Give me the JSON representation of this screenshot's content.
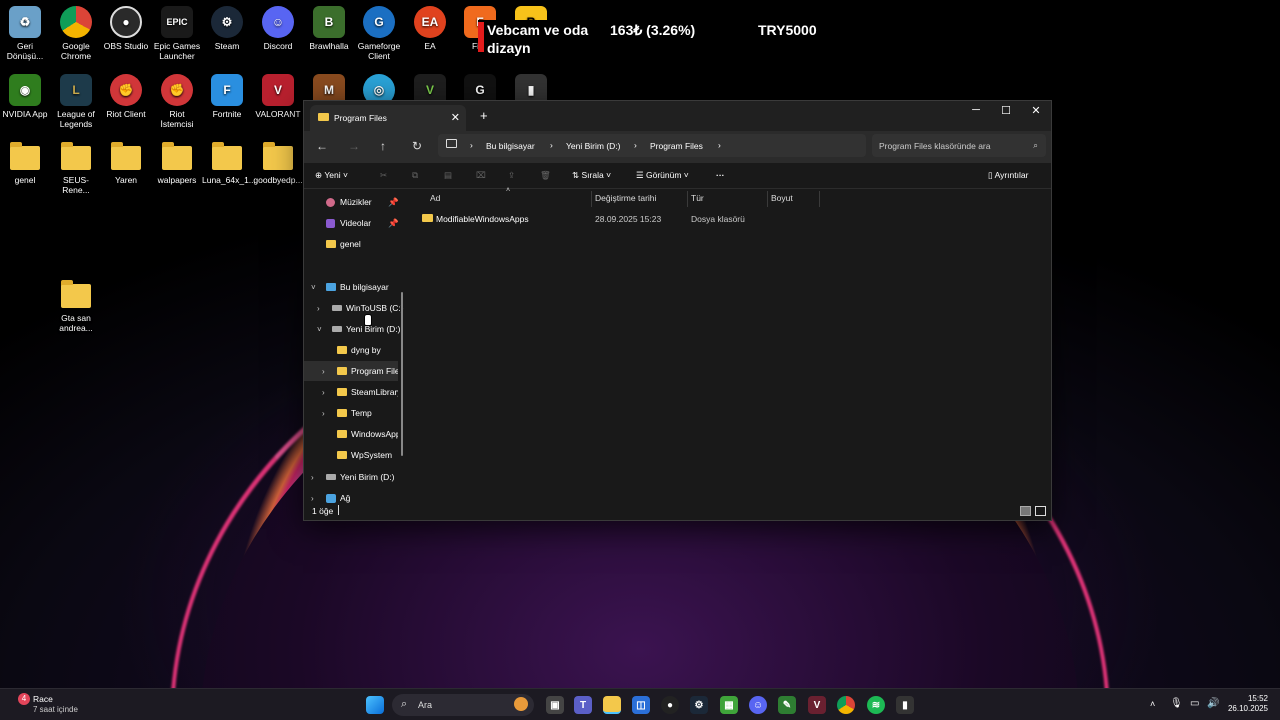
{
  "desktop": {
    "icons": [
      {
        "label": "Geri Dönüşü...",
        "icon": "recycle-bin-icon",
        "color": "#6aa0c8"
      },
      {
        "label": "Google Chrome",
        "icon": "chrome-icon",
        "color": "#2f8f46"
      },
      {
        "label": "OBS Studio",
        "icon": "obs-icon",
        "color": "#2a2a2a"
      },
      {
        "label": "Epic Games Launcher",
        "icon": "epic-games-icon",
        "color": "#1a1a1a"
      },
      {
        "label": "Steam",
        "icon": "steam-icon",
        "color": "#1b2838"
      },
      {
        "label": "Discord",
        "icon": "discord-icon",
        "color": "#5865f2"
      },
      {
        "label": "Brawlhalla",
        "icon": "brawlhalla-icon",
        "color": "#3b6e2c"
      },
      {
        "label": "Gameforge Client",
        "icon": "gameforge-icon",
        "color": "#1b6fc2"
      },
      {
        "label": "EA",
        "icon": "ea-icon",
        "color": "#e0421e"
      },
      {
        "label": "Five",
        "icon": "fivem-icon",
        "color": "#f06a1d"
      },
      {
        "label": "NVIDIA App",
        "icon": "nvidia-icon",
        "color": "#2f7d1e"
      },
      {
        "label": "League of Legends",
        "icon": "league-icon",
        "color": "#1d3a4a"
      },
      {
        "label": "Riot Client",
        "icon": "riot-client-icon",
        "color": "#d13639"
      },
      {
        "label": "Riot İstemcisi",
        "icon": "riot-istemcisi-icon",
        "color": "#d13639"
      },
      {
        "label": "Fortnite",
        "icon": "fortnite-icon",
        "color": "#2a8fe0"
      },
      {
        "label": "VALORANT",
        "icon": "valorant-icon",
        "color": "#b8202e"
      },
      {
        "label": "genel",
        "icon": "folder-icon",
        "color": "#f3c84b"
      },
      {
        "label": "SEUS-Rene...",
        "icon": "folder-icon",
        "color": "#f3c84b"
      },
      {
        "label": "Yaren",
        "icon": "folder-icon",
        "color": "#f3c84b"
      },
      {
        "label": "walpapers",
        "icon": "folder-icon",
        "color": "#f3c84b"
      },
      {
        "label": "Luna_64x_1...",
        "icon": "folder-icon",
        "color": "#f3c84b"
      },
      {
        "label": "goodbyedp...",
        "icon": "folder-icon",
        "color": "#f3c84b"
      },
      {
        "label": "Gta san andrea...",
        "icon": "folder-icon",
        "color": "#f3c84b"
      }
    ]
  },
  "overlay": {
    "left_line1": "Vebcam ve oda",
    "left_line2": "dizayn",
    "amount": "163₺ (3.26%)",
    "goal": "TRY5000"
  },
  "explorer": {
    "tab_title": "Program Files",
    "breadcrumb": [
      "Bu bilgisayar",
      "Yeni Birim (D:)",
      "Program Files"
    ],
    "search_placeholder": "Program Files klasöründe ara",
    "toolbar": {
      "new": "Yeni",
      "sort": "Sırala",
      "view": "Görünüm",
      "details": "Ayrıntılar"
    },
    "sidebar": {
      "items": [
        "Müzikler",
        "Videolar",
        "genel",
        "Bu bilgisayar",
        "WinToUSB (C:)",
        "Yeni Birim (D:)",
        "dyng by",
        "Program Files",
        "SteamLibrary",
        "Temp",
        "WindowsApps",
        "WpSystem",
        "Yeni Birim (D:)",
        "Ağ"
      ]
    },
    "columns": [
      "Ad",
      "Değiştirme tarihi",
      "Tür",
      "Boyut"
    ],
    "rows": [
      {
        "name": "ModifiableWindowsApps",
        "date": "28.09.2025 15:23",
        "type": "Dosya klasörü",
        "size": ""
      }
    ],
    "status": "1 öğe"
  },
  "taskbar": {
    "weather_label": "Race",
    "weather_sub": "7 saat içinde",
    "weather_badge": "4",
    "search": "Ara",
    "time": "15:52",
    "date": "26.10.2025"
  }
}
